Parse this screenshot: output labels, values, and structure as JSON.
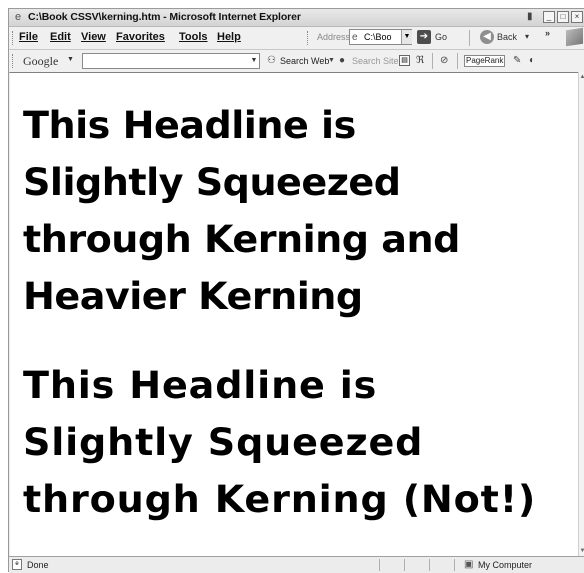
{
  "window": {
    "title": "C:\\Book CSSV\\kerning.htm - Microsoft Internet Explorer"
  },
  "menu": {
    "items": [
      {
        "key": "file",
        "label": "File"
      },
      {
        "key": "edit",
        "label": "Edit"
      },
      {
        "key": "view",
        "label": "View"
      },
      {
        "key": "favorites",
        "label": "Favorites"
      },
      {
        "key": "tools",
        "label": "Tools"
      },
      {
        "key": "help",
        "label": "Help"
      }
    ]
  },
  "address": {
    "label": "Address",
    "value": "C:\\Boo",
    "go_label": "Go"
  },
  "nav": {
    "back_label": "Back",
    "more_chevron": "»"
  },
  "google_toolbar": {
    "logo": "Google",
    "search_web": "Search Web",
    "search_site": "Search Site",
    "pagerank": "PageRank"
  },
  "content": {
    "headline_1_lines": [
      "This Headline is",
      "Slightly Squeezed",
      "through Kerning and",
      "Heavier Kerning"
    ],
    "headline_2_lines": [
      "This Headline is",
      "Slightly Squeezed",
      "through Kerning (Not!)"
    ]
  },
  "status": {
    "text": "Done",
    "zone": "My Computer"
  },
  "icons": {
    "page": "ie-page-icon",
    "go": "go-arrow-icon",
    "back": "back-arrow-icon",
    "computer": "my-computer-icon"
  }
}
